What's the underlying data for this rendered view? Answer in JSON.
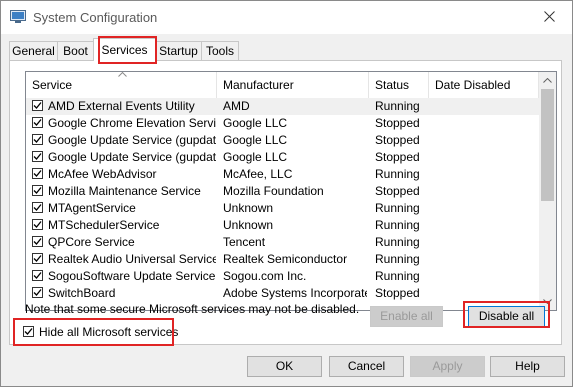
{
  "window": {
    "title": "System Configuration"
  },
  "tabs": [
    {
      "label": "General"
    },
    {
      "label": "Boot"
    },
    {
      "label": "Services"
    },
    {
      "label": "Startup"
    },
    {
      "label": "Tools"
    }
  ],
  "active_tab": "Services",
  "list": {
    "columns": [
      "Service",
      "Manufacturer",
      "Status",
      "Date Disabled"
    ],
    "rows": [
      {
        "service": "AMD External Events Utility",
        "manufacturer": "AMD",
        "status": "Running",
        "date_disabled": "",
        "checked": true
      },
      {
        "service": "Google Chrome Elevation Service",
        "manufacturer": "Google LLC",
        "status": "Stopped",
        "date_disabled": "",
        "checked": true
      },
      {
        "service": "Google Update Service (gupdate)",
        "manufacturer": "Google LLC",
        "status": "Stopped",
        "date_disabled": "",
        "checked": true
      },
      {
        "service": "Google Update Service (gupdatem)",
        "manufacturer": "Google LLC",
        "status": "Stopped",
        "date_disabled": "",
        "checked": true
      },
      {
        "service": "McAfee WebAdvisor",
        "manufacturer": "McAfee, LLC",
        "status": "Running",
        "date_disabled": "",
        "checked": true
      },
      {
        "service": "Mozilla Maintenance Service",
        "manufacturer": "Mozilla Foundation",
        "status": "Stopped",
        "date_disabled": "",
        "checked": true
      },
      {
        "service": "MTAgentService",
        "manufacturer": "Unknown",
        "status": "Running",
        "date_disabled": "",
        "checked": true
      },
      {
        "service": "MTSchedulerService",
        "manufacturer": "Unknown",
        "status": "Running",
        "date_disabled": "",
        "checked": true
      },
      {
        "service": "QPCore Service",
        "manufacturer": "Tencent",
        "status": "Running",
        "date_disabled": "",
        "checked": true
      },
      {
        "service": "Realtek Audio Universal Service",
        "manufacturer": "Realtek Semiconductor",
        "status": "Running",
        "date_disabled": "",
        "checked": true
      },
      {
        "service": "SogouSoftware Update Service ...",
        "manufacturer": "Sogou.com Inc.",
        "status": "Running",
        "date_disabled": "",
        "checked": true
      },
      {
        "service": "SwitchBoard",
        "manufacturer": "Adobe Systems Incorporated",
        "status": "Stopped",
        "date_disabled": "",
        "checked": true
      }
    ]
  },
  "note": "Note that some secure Microsoft services may not be disabled.",
  "buttons": {
    "enable_all": "Enable all",
    "disable_all": "Disable all",
    "ok": "OK",
    "cancel": "Cancel",
    "apply": "Apply",
    "help": "Help"
  },
  "hide_ms": {
    "label": "Hide all Microsoft services",
    "checked": true
  },
  "icons": {
    "app": "system-configuration-icon",
    "close": "close-icon",
    "sort": "sort-ascending-icon",
    "scroll_up": "scroll-up-icon",
    "scroll_down": "scroll-down-icon",
    "check": "checkmark-icon"
  },
  "colors": {
    "highlight": "#e02424",
    "focus_border": "#0078d7"
  }
}
